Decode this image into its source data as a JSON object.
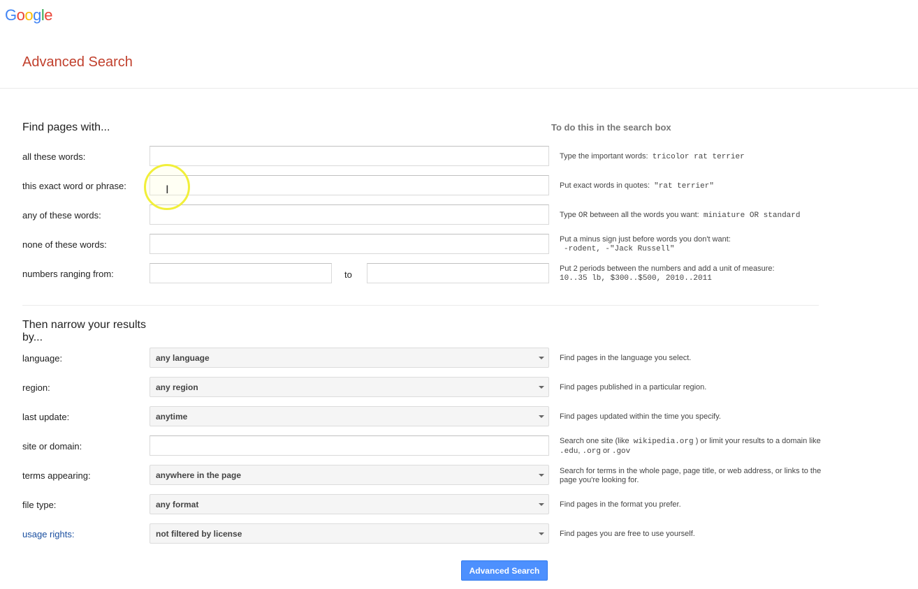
{
  "brand": {
    "letters": [
      "G",
      "o",
      "o",
      "g",
      "l",
      "e"
    ],
    "colors": [
      "#4285f4",
      "#ea4335",
      "#fbbc05",
      "#4285f4",
      "#34a853",
      "#ea4335"
    ]
  },
  "page_title": "Advanced Search",
  "find_section": {
    "title": "Find pages with...",
    "howto_title": "To do this in the search box",
    "rows": [
      {
        "label": "all these words:",
        "value": "",
        "tip": "Type the important words:",
        "tip_code": "tricolor rat terrier"
      },
      {
        "label": "this exact word or phrase:",
        "value": "",
        "tip": "Put exact words in quotes:",
        "tip_code": "\"rat terrier\""
      },
      {
        "label": "any of these words:",
        "value": "",
        "tip_a": "Type",
        "tip_or": "OR",
        "tip_b": "between all the words you want:",
        "tip_code": "miniature OR standard"
      },
      {
        "label": "none of these words:",
        "value": "",
        "tip": "Put a minus sign just before words you don't want:",
        "tip_code": "-rodent, -\"Jack Russell\""
      },
      {
        "label": "numbers ranging from:",
        "value_from": "",
        "to_label": "to",
        "value_to": "",
        "tip": "Put 2 periods between the numbers and add a unit of measure:",
        "tip_code": "10..35 lb, $300..$500, 2010..2011"
      }
    ]
  },
  "narrow_section": {
    "title": "Then narrow your results by...",
    "rows": [
      {
        "label": "language:",
        "selected": "any language",
        "tip": "Find pages in the language you select."
      },
      {
        "label": "region:",
        "selected": "any region",
        "tip": "Find pages published in a particular region."
      },
      {
        "label": "last update:",
        "selected": "anytime",
        "tip": "Find pages updated within the time you specify."
      },
      {
        "label": "site or domain:",
        "value": "",
        "tip_a": "Search one site (like",
        "tip_code_a": "wikipedia.org",
        "tip_b": ") or limit your results to a domain like",
        "tip_code_b": ".edu",
        "tip_c": ",",
        "tip_code_c": ".org",
        "tip_d": "or",
        "tip_code_d": ".gov"
      },
      {
        "label": "terms appearing:",
        "selected": "anywhere in the page",
        "tip": "Search for terms in the whole page, page title, or web address, or links to the page you're looking for."
      },
      {
        "label": "file type:",
        "selected": "any format",
        "tip": "Find pages in the format you prefer."
      },
      {
        "label": "usage rights:",
        "selected": "not filtered by license",
        "tip": "Find pages you are free to use yourself."
      }
    ]
  },
  "submit_label": "Advanced Search"
}
